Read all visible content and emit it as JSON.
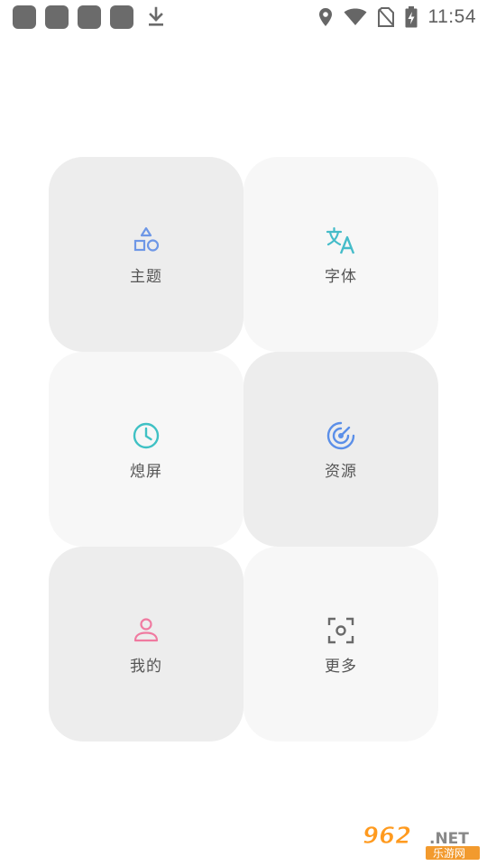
{
  "status_bar": {
    "time": "11:54",
    "notification_icons": [
      "app-notification-icon",
      "app-notification-icon",
      "app-notification-icon",
      "app-notification-icon",
      "download-icon"
    ],
    "system_icons": [
      "location-icon",
      "wifi-icon",
      "no-sim-icon",
      "battery-charging-icon"
    ]
  },
  "tiles": [
    {
      "label": "主题",
      "icon": "shapes-icon",
      "color": "#6e97e6"
    },
    {
      "label": "字体",
      "icon": "translate-icon",
      "color": "#45bcc9"
    },
    {
      "label": "熄屏",
      "icon": "clock-icon",
      "color": "#3fc1c4"
    },
    {
      "label": "资源",
      "icon": "radar-icon",
      "color": "#5b8fe8"
    },
    {
      "label": "我的",
      "icon": "person-icon",
      "color": "#f07aa0"
    },
    {
      "label": "更多",
      "icon": "scan-icon",
      "color": "#6a6a6a"
    }
  ],
  "watermark": {
    "number": "962",
    "suffix": ".NET",
    "site": "乐游网"
  }
}
